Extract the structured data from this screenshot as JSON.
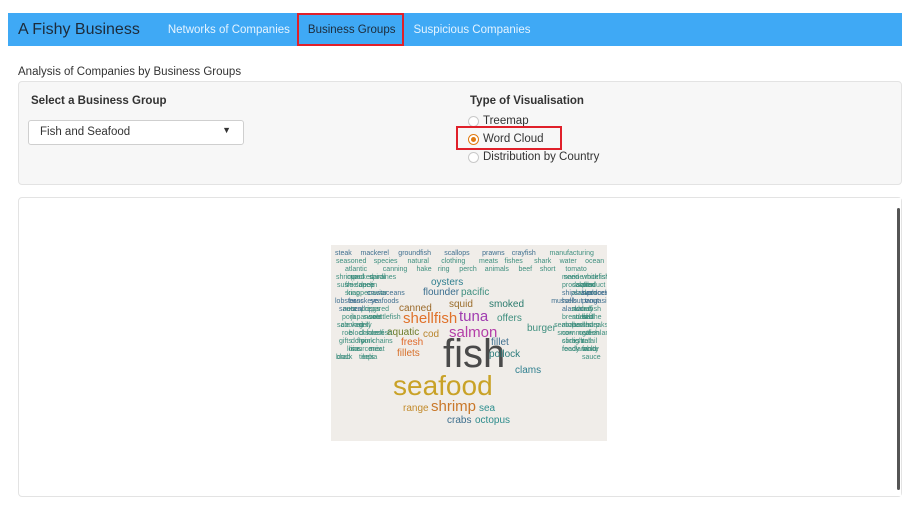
{
  "navbar": {
    "brand": "A Fishy Business",
    "links": [
      "Networks of Companies",
      "Business Groups",
      "Suspicious Companies"
    ],
    "active_link": "Business Groups"
  },
  "subtitle": "Analysis of Companies by Business Groups",
  "controls": {
    "group_label": "Select a Business Group",
    "group_value": "Fish and Seafood",
    "vis_label": "Type of Visualisation",
    "vis_options": [
      "Treemap",
      "Word Cloud",
      "Distribution by Country"
    ],
    "vis_selected": "Word Cloud"
  },
  "wordcloud": {
    "words": [
      {
        "text": "fish",
        "weight": 5,
        "color": "#4a4a4a"
      },
      {
        "text": "seafood",
        "weight": 4,
        "color": "#c9a227"
      },
      {
        "text": "salmon",
        "weight": 3,
        "color": "#b43ea8"
      },
      {
        "text": "shellfish",
        "weight": 3,
        "color": "#e0722b"
      },
      {
        "text": "tuna",
        "weight": 3,
        "color": "#a03cb0"
      },
      {
        "text": "shrimp",
        "weight": 3,
        "color": "#c9782a"
      },
      {
        "text": "squid",
        "weight": 2,
        "color": "#9a6c2a"
      },
      {
        "text": "cod",
        "weight": 2,
        "color": "#b9862c"
      },
      {
        "text": "fresh",
        "weight": 2,
        "color": "#e06a2b"
      },
      {
        "text": "fillets",
        "weight": 2,
        "color": "#d8702a"
      },
      {
        "text": "pollock",
        "weight": 2,
        "color": "#2d7c7c"
      },
      {
        "text": "octopus",
        "weight": 2,
        "color": "#2d8c8c"
      },
      {
        "text": "crabs",
        "weight": 2,
        "color": "#3c6e8c"
      },
      {
        "text": "canned",
        "weight": 2,
        "color": "#9b6a2a"
      },
      {
        "text": "smoked",
        "weight": 2,
        "color": "#2a7b6e"
      },
      {
        "text": "offers",
        "weight": 2,
        "color": "#3f8f7f"
      },
      {
        "text": "flounder",
        "weight": 2,
        "color": "#3b6f8f"
      },
      {
        "text": "pacific",
        "weight": 2,
        "color": "#3f8f7f"
      },
      {
        "text": "oysters",
        "weight": 2,
        "color": "#2f7f8f"
      },
      {
        "text": "range",
        "weight": 2,
        "color": "#c28a2a"
      },
      {
        "text": "sea",
        "weight": 2,
        "color": "#2f8f8f"
      },
      {
        "text": "clams",
        "weight": 2,
        "color": "#2f7f8f"
      },
      {
        "text": "aquatic",
        "weight": 2,
        "color": "#6c7c2a"
      },
      {
        "text": "fillet",
        "weight": 2,
        "color": "#3f6f8f"
      },
      {
        "text": "burger",
        "weight": 2,
        "color": "#3f8f7f"
      },
      {
        "text": "steak",
        "weight": 1,
        "color": "#3f6f8f"
      },
      {
        "text": "mackerel",
        "weight": 1,
        "color": "#3f6f8f"
      },
      {
        "text": "groundfish",
        "weight": 1,
        "color": "#3f6f8f"
      },
      {
        "text": "scallops",
        "weight": 1,
        "color": "#3f6f8f"
      },
      {
        "text": "prawns",
        "weight": 1,
        "color": "#3f6f8f"
      },
      {
        "text": "crayfish",
        "weight": 1,
        "color": "#3f6f8f"
      },
      {
        "text": "manufacturing",
        "weight": 1,
        "color": "#3f8f7f"
      },
      {
        "text": "seasoned",
        "weight": 1,
        "color": "#3f8f7f"
      },
      {
        "text": "species",
        "weight": 1,
        "color": "#3f8f7f"
      },
      {
        "text": "natural",
        "weight": 1,
        "color": "#3f8f7f"
      },
      {
        "text": "clothing",
        "weight": 1,
        "color": "#3f8f7f"
      },
      {
        "text": "meats",
        "weight": 1,
        "color": "#3f8f7f"
      },
      {
        "text": "fishes",
        "weight": 1,
        "color": "#3f8f7f"
      },
      {
        "text": "shark",
        "weight": 1,
        "color": "#3f8f7f"
      },
      {
        "text": "water",
        "weight": 1,
        "color": "#3f8f7f"
      },
      {
        "text": "ocean",
        "weight": 1,
        "color": "#3f8f7f"
      },
      {
        "text": "atlantic",
        "weight": 1,
        "color": "#3f8f7f"
      },
      {
        "text": "canning",
        "weight": 1,
        "color": "#3f8f7f"
      },
      {
        "text": "hake",
        "weight": 1,
        "color": "#3f8f7f"
      },
      {
        "text": "ring",
        "weight": 1,
        "color": "#3f8f7f"
      },
      {
        "text": "perch",
        "weight": 1,
        "color": "#3f8f7f"
      },
      {
        "text": "animals",
        "weight": 1,
        "color": "#3f8f7f"
      },
      {
        "text": "beef",
        "weight": 1,
        "color": "#3f8f7f"
      },
      {
        "text": "short",
        "weight": 1,
        "color": "#3f8f7f"
      },
      {
        "text": "tomato",
        "weight": 1,
        "color": "#3f8f7f"
      },
      {
        "text": "shrimps",
        "weight": 1,
        "color": "#3f8f7f"
      },
      {
        "text": "sardines",
        "weight": 1,
        "color": "#3f8f7f"
      },
      {
        "text": "cured",
        "weight": 1,
        "color": "#3f8f7f"
      },
      {
        "text": "whitefish",
        "weight": 1,
        "color": "#3f8f7f"
      },
      {
        "text": "spiral",
        "weight": 1,
        "color": "#3f8f7f"
      },
      {
        "text": "marine",
        "weight": 1,
        "color": "#3f8f7f"
      },
      {
        "text": "packed",
        "weight": 1,
        "color": "#3f8f7f"
      },
      {
        "text": "seed",
        "weight": 1,
        "color": "#3f8f7f"
      },
      {
        "text": "rockfish",
        "weight": 1,
        "color": "#3f8f7f"
      },
      {
        "text": "freelance",
        "weight": 1,
        "color": "#3f8f7f"
      },
      {
        "text": "capelin",
        "weight": 1,
        "color": "#3f8f7f"
      },
      {
        "text": "production",
        "weight": 1,
        "color": "#3f8f7f"
      },
      {
        "text": "sushi",
        "weight": 1,
        "color": "#3f8f7f"
      },
      {
        "text": "salads",
        "weight": 1,
        "color": "#3f8f7f"
      },
      {
        "text": "deep",
        "weight": 1,
        "color": "#3f8f7f"
      },
      {
        "text": "product",
        "weight": 1,
        "color": "#3f8f7f"
      },
      {
        "text": "salted",
        "weight": 1,
        "color": "#3f8f7f"
      },
      {
        "text": "king",
        "weight": 1,
        "color": "#3f8f7f"
      },
      {
        "text": "caviar",
        "weight": 1,
        "color": "#3f8f7f"
      },
      {
        "text": "alaskan",
        "weight": 1,
        "color": "#3f8f7f"
      },
      {
        "text": "snapper",
        "weight": 1,
        "color": "#3f8f7f"
      },
      {
        "text": "haddock",
        "weight": 1,
        "color": "#3f6f8f"
      },
      {
        "text": "crustaceans",
        "weight": 1,
        "color": "#3f6f8f"
      },
      {
        "text": "shipsraw",
        "weight": 1,
        "color": "#3f6f8f"
      },
      {
        "text": "processed",
        "weight": 1,
        "color": "#3f6f8f"
      },
      {
        "text": "bass",
        "weight": 1,
        "color": "#3f6f8f"
      },
      {
        "text": "seafoods",
        "weight": 1,
        "color": "#3f6f8f"
      },
      {
        "text": "pangasius",
        "weight": 1,
        "color": "#3f6f8f"
      },
      {
        "text": "sockeye",
        "weight": 1,
        "color": "#3f6f8f"
      },
      {
        "text": "halibut",
        "weight": 1,
        "color": "#3f6f8f"
      },
      {
        "text": "lobster",
        "weight": 1,
        "color": "#3f6f8f"
      },
      {
        "text": "mussels",
        "weight": 1,
        "color": "#3f6f8f"
      },
      {
        "text": "trout",
        "weight": 1,
        "color": "#3f6f8f"
      },
      {
        "text": "scallop",
        "weight": 1,
        "color": "#3f6f8f"
      },
      {
        "text": "sauces",
        "weight": 1,
        "color": "#3f6f8f"
      },
      {
        "text": "alaska",
        "weight": 1,
        "color": "#3f6f8f"
      },
      {
        "text": "prepared",
        "weight": 1,
        "color": "#3f8f7f"
      },
      {
        "text": "added",
        "weight": 1,
        "color": "#3f8f7f"
      },
      {
        "text": "nets",
        "weight": 1,
        "color": "#3f8f7f"
      },
      {
        "text": "bay",
        "weight": 1,
        "color": "#3f8f7f"
      },
      {
        "text": "rings",
        "weight": 1,
        "color": "#3f8f7f"
      },
      {
        "text": "swordfish",
        "weight": 1,
        "color": "#3f8f7f"
      },
      {
        "text": "pork",
        "weight": 1,
        "color": "#3f8f7f"
      },
      {
        "text": "sweet",
        "weight": 1,
        "color": "#3f8f7f"
      },
      {
        "text": "sole",
        "weight": 1,
        "color": "#3f8f7f"
      },
      {
        "text": "wild",
        "weight": 1,
        "color": "#3f8f7f"
      },
      {
        "text": "japanese",
        "weight": 1,
        "color": "#3f8f7f"
      },
      {
        "text": "breaded",
        "weight": 1,
        "color": "#3f8f7f"
      },
      {
        "text": "cuttlefish",
        "weight": 1,
        "color": "#3f8f7f"
      },
      {
        "text": "stuffed",
        "weight": 1,
        "color": "#3f8f7f"
      },
      {
        "text": "saithe",
        "weight": 1,
        "color": "#3f8f7f"
      },
      {
        "text": "variety",
        "weight": 1,
        "color": "#3f8f7f"
      },
      {
        "text": "sale",
        "weight": 1,
        "color": "#3f8f7f"
      },
      {
        "text": "mollusks",
        "weight": 1,
        "color": "#3f8f7f"
      },
      {
        "text": "grill",
        "weight": 1,
        "color": "#3f8f7f"
      },
      {
        "text": "peeled",
        "weight": 1,
        "color": "#3f8f7f"
      },
      {
        "text": "cooked",
        "weight": 1,
        "color": "#3f8f7f"
      },
      {
        "text": "churp",
        "weight": 1,
        "color": "#3f8f7f"
      },
      {
        "text": "seabass",
        "weight": 1,
        "color": "#3f8f7f"
      },
      {
        "text": "steaks",
        "weight": 1,
        "color": "#3f8f7f"
      },
      {
        "text": "roe",
        "weight": 1,
        "color": "#3f8f7f"
      },
      {
        "text": "chicken",
        "weight": 1,
        "color": "#3f8f7f"
      },
      {
        "text": "home",
        "weight": 1,
        "color": "#3f8f7f"
      },
      {
        "text": "greenland",
        "weight": 1,
        "color": "#3f8f7f"
      },
      {
        "text": "blocks",
        "weight": 1,
        "color": "#3f8f7f"
      },
      {
        "text": "cornmeal",
        "weight": 1,
        "color": "#3f8f7f"
      },
      {
        "text": "redfish",
        "weight": 1,
        "color": "#3f8f7f"
      },
      {
        "text": "snow",
        "weight": 1,
        "color": "#3f8f7f"
      },
      {
        "text": "catfish",
        "weight": 1,
        "color": "#3f8f7f"
      },
      {
        "text": "dory",
        "weight": 1,
        "color": "#3f8f7f"
      },
      {
        "text": "chains",
        "weight": 1,
        "color": "#3f8f7f"
      },
      {
        "text": "corn",
        "weight": 1,
        "color": "#3f8f7f"
      },
      {
        "text": "floor",
        "weight": 1,
        "color": "#3f8f7f"
      },
      {
        "text": "light",
        "weight": 1,
        "color": "#3f8f7f"
      },
      {
        "text": "gifts",
        "weight": 1,
        "color": "#3f8f7f"
      },
      {
        "text": "retail",
        "weight": 1,
        "color": "#3f8f7f"
      },
      {
        "text": "pink",
        "weight": 1,
        "color": "#3f8f7f"
      },
      {
        "text": "slices",
        "weight": 1,
        "color": "#3f8f7f"
      },
      {
        "text": "ball",
        "weight": 1,
        "color": "#3f8f7f"
      },
      {
        "text": "line",
        "weight": 1,
        "color": "#3f8f7f"
      },
      {
        "text": "mix",
        "weight": 1,
        "color": "#3f8f7f"
      },
      {
        "text": "fancy",
        "weight": 1,
        "color": "#3f8f7f"
      },
      {
        "text": "loins",
        "weight": 1,
        "color": "#3f8f7f"
      },
      {
        "text": "ready",
        "weight": 1,
        "color": "#3f8f7f"
      },
      {
        "text": "meat",
        "weight": 1,
        "color": "#3f8f7f"
      },
      {
        "text": "clam",
        "weight": 1,
        "color": "#3f8f7f"
      },
      {
        "text": "source",
        "weight": 1,
        "color": "#3f8f7f"
      },
      {
        "text": "white",
        "weight": 1,
        "color": "#3f8f7f"
      },
      {
        "text": "food",
        "weight": 1,
        "color": "#3f8f7f"
      },
      {
        "text": "cold",
        "weight": 1,
        "color": "#3f8f7f"
      },
      {
        "text": "black",
        "weight": 1,
        "color": "#3f8f7f"
      },
      {
        "text": "eels",
        "weight": 1,
        "color": "#3f8f7f"
      },
      {
        "text": "crab",
        "weight": 1,
        "color": "#3f8f7f"
      },
      {
        "text": "sauce",
        "weight": 1,
        "color": "#3f8f7f"
      },
      {
        "text": "tilapia",
        "weight": 1,
        "color": "#3f8f7f"
      }
    ]
  }
}
